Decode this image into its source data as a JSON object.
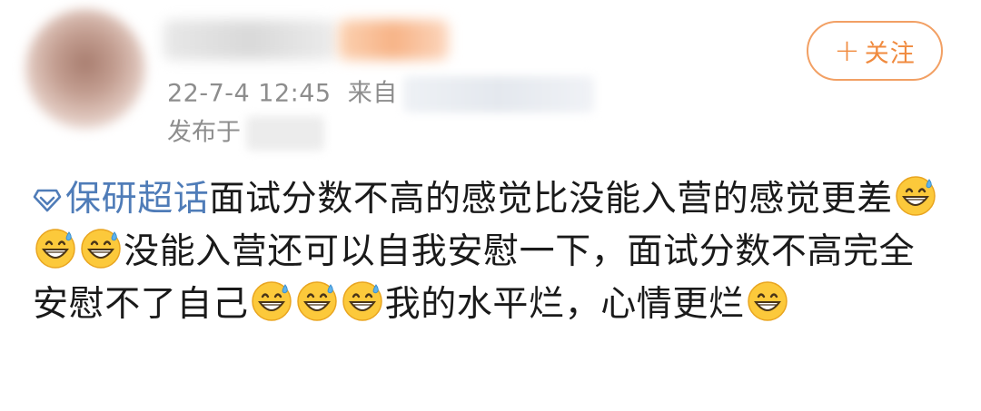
{
  "header": {
    "timestamp": "22-7-4 12:45",
    "source_prefix": "来自",
    "published_prefix": "发布于"
  },
  "follow_button": {
    "label": "关注",
    "plus": "+"
  },
  "post": {
    "topic": "保研超话",
    "text_1": "面试分数不高的感觉比没能入营的感觉更差",
    "text_2": "没能入营还可以自我安慰一下，面试分数不高完全安慰不了自己",
    "text_3": "我的水平烂，心情更烂",
    "emoji_sweat": "grinning-face-with-sweat",
    "emoji_grin": "beaming-face-with-smiling-eyes"
  },
  "colors": {
    "topic": "#4f7cb8",
    "follow": "#f08a3e",
    "meta": "#8d8d8d"
  }
}
